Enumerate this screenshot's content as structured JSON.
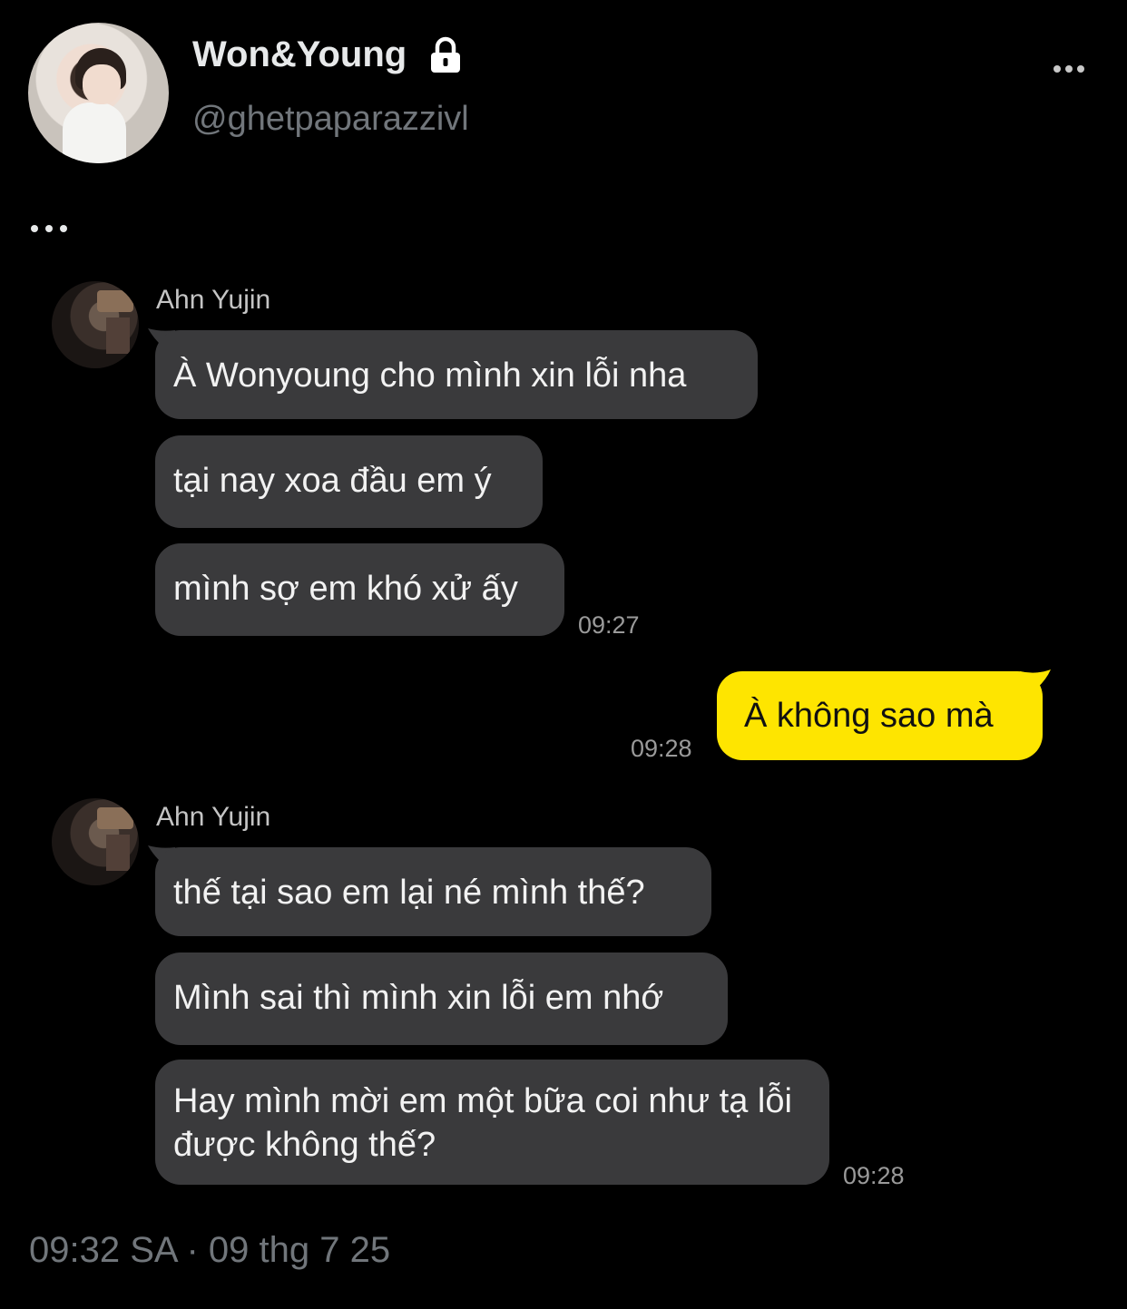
{
  "header": {
    "display_name": "Won&Young",
    "handle": "@ghetpaparazzivl"
  },
  "chat": {
    "groups": [
      {
        "sender": "Ahn Yujin",
        "messages": [
          "À Wonyoung cho mình xin lỗi nha",
          "tại nay xoa đầu em ý",
          "mình sợ em khó xử ấy"
        ],
        "time": "09:27"
      },
      {
        "sender": "me",
        "messages": [
          "À không sao mà"
        ],
        "time": "09:28"
      },
      {
        "sender": "Ahn Yujin",
        "messages": [
          "thế tại sao em lại né mình thế?",
          "Mình sai thì mình xin lỗi em nhớ",
          "Hay mình mời em một bữa coi như tạ lỗi được không thế?"
        ],
        "time": "09:28"
      }
    ]
  },
  "footer": {
    "timestamp": "09:32 SA · 09 thg 7 25"
  },
  "colors": {
    "background": "#000000",
    "incoming_bubble": "#3a3a3c",
    "outgoing_bubble": "#fee500",
    "secondary_text": "#71767b"
  },
  "icons": [
    "lock-icon",
    "more-icon",
    "ellipsis-icon"
  ]
}
